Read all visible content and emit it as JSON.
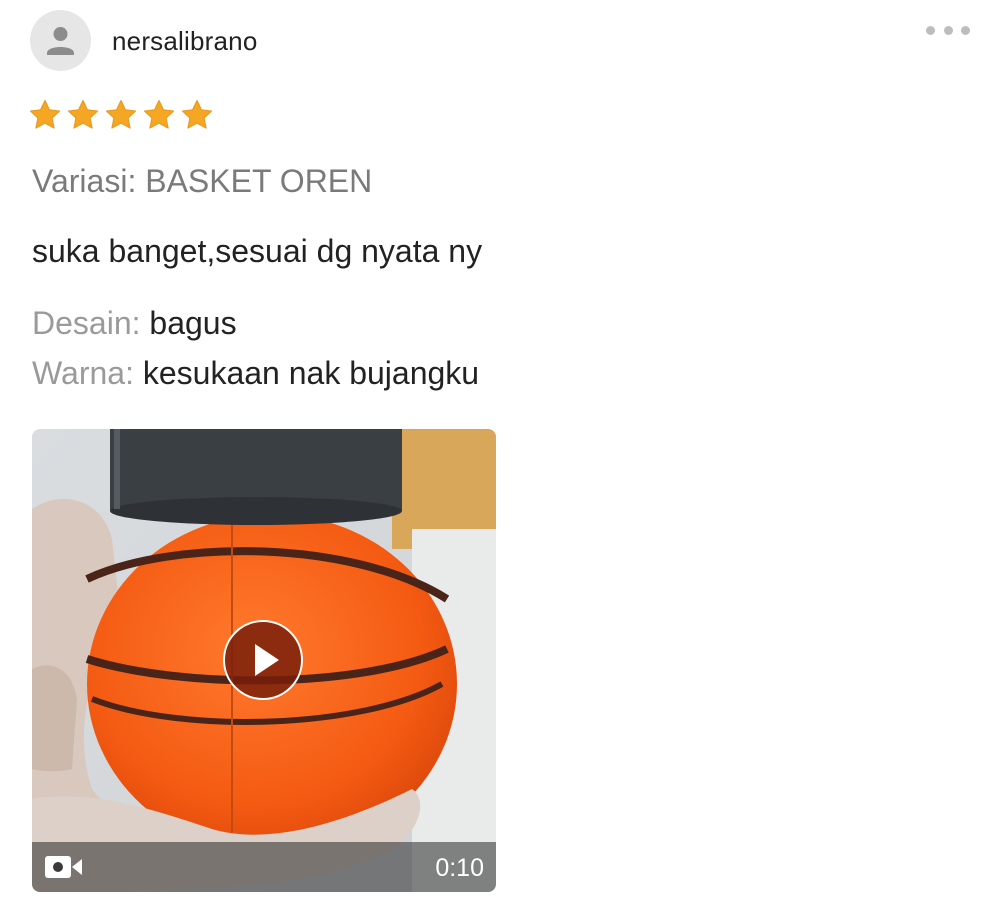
{
  "review": {
    "username": "nersalibrano",
    "rating": 5,
    "rating_max": 5,
    "variation": "Variasi: BASKET OREN",
    "comment": "suka banget,sesuai dg nyata ny",
    "attributes": [
      {
        "key": "Desain:",
        "value": "bagus"
      },
      {
        "key": "Warna:",
        "value": "kesukaan nak bujangku"
      }
    ],
    "video": {
      "duration": "0:10"
    }
  },
  "icons": {
    "avatar": "user-icon",
    "menu": "more-dots-icon",
    "star": "star-icon",
    "play": "play-icon",
    "video": "video-camera-icon"
  },
  "colors": {
    "star": "#F5A623",
    "star_dark": "#E89A1E",
    "text_primary": "#222222",
    "text_secondary": "#7A7A7A",
    "text_label": "#9A9A9A",
    "avatar_bg": "#E6E6E6",
    "avatar_icon": "#8C8C8C"
  }
}
